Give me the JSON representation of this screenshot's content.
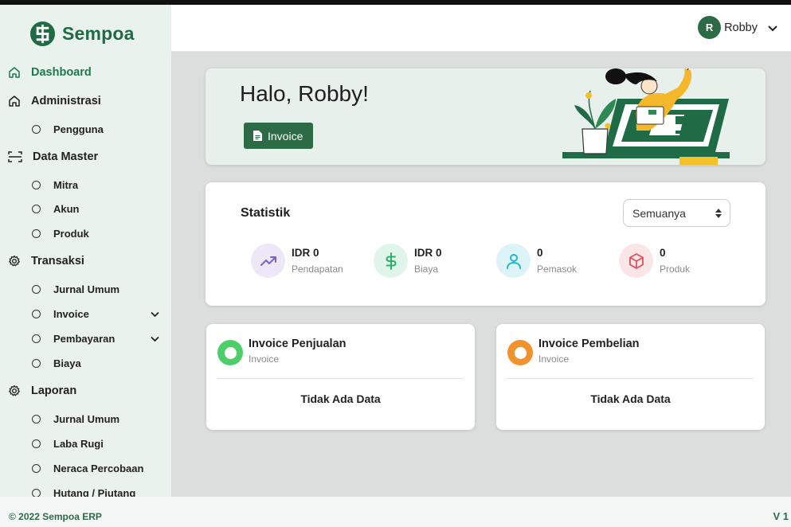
{
  "app": {
    "logo_text": "Sempoa"
  },
  "sidebar": {
    "items": [
      {
        "label": "Dashboard",
        "icon": "home-icon",
        "active": true
      },
      {
        "label": "Administrasi",
        "icon": "home-icon"
      },
      {
        "label": "Pengguna",
        "sub": true
      },
      {
        "label": "Data Master",
        "icon": "scan-icon"
      },
      {
        "label": "Mitra",
        "sub": true
      },
      {
        "label": "Akun",
        "sub": true
      },
      {
        "label": "Produk",
        "sub": true
      },
      {
        "label": "Transaksi",
        "icon": "gear-icon"
      },
      {
        "label": "Jurnal Umum",
        "sub": true
      },
      {
        "label": "Invoice",
        "sub": true,
        "expandable": true
      },
      {
        "label": "Pembayaran",
        "sub": true,
        "expandable": true
      },
      {
        "label": "Biaya",
        "sub": true
      },
      {
        "label": "Laporan",
        "icon": "gear-icon"
      },
      {
        "label": "Jurnal Umum",
        "sub": true
      },
      {
        "label": "Laba Rugi",
        "sub": true
      },
      {
        "label": "Neraca Percobaan",
        "sub": true
      },
      {
        "label": "Hutang / Piutang",
        "sub": true
      }
    ]
  },
  "header": {
    "user_initial": "R",
    "user_name": "Robby"
  },
  "hero": {
    "greeting": "Halo, Robby!",
    "button_label": "Invoice"
  },
  "stats": {
    "title": "Statistik",
    "filter_value": "Semuanya",
    "cards": [
      {
        "value": "IDR 0",
        "label": "Pendapatan",
        "icon": "trending-up-icon",
        "color": "#7b61c9",
        "bg": "#ece8f8"
      },
      {
        "value": "IDR 0",
        "label": "Biaya",
        "icon": "dollar-icon",
        "color": "#2fae6a",
        "bg": "#e0f5ea"
      },
      {
        "value": "0",
        "label": "Pemasok",
        "icon": "user-icon",
        "color": "#22b5cf",
        "bg": "#dcf4f8"
      },
      {
        "value": "0",
        "label": "Produk",
        "icon": "box-icon",
        "color": "#e0525c",
        "bg": "#fbe6e7"
      }
    ]
  },
  "invoices": [
    {
      "title": "Invoice Penjualan",
      "subtitle": "Invoice",
      "empty_text": "Tidak Ada Data",
      "color": "#4cce6a"
    },
    {
      "title": "Invoice Pembelian",
      "subtitle": "Invoice",
      "empty_text": "Tidak Ada Data",
      "color": "#f2922b"
    }
  ],
  "footer": {
    "copyright": "© 2022 Sempoa ERP",
    "version": "V 1"
  },
  "colors": {
    "brand": "#2d6a46",
    "sidebar_bg": "#eaf2ee",
    "page_bg": "#dcdedd"
  }
}
